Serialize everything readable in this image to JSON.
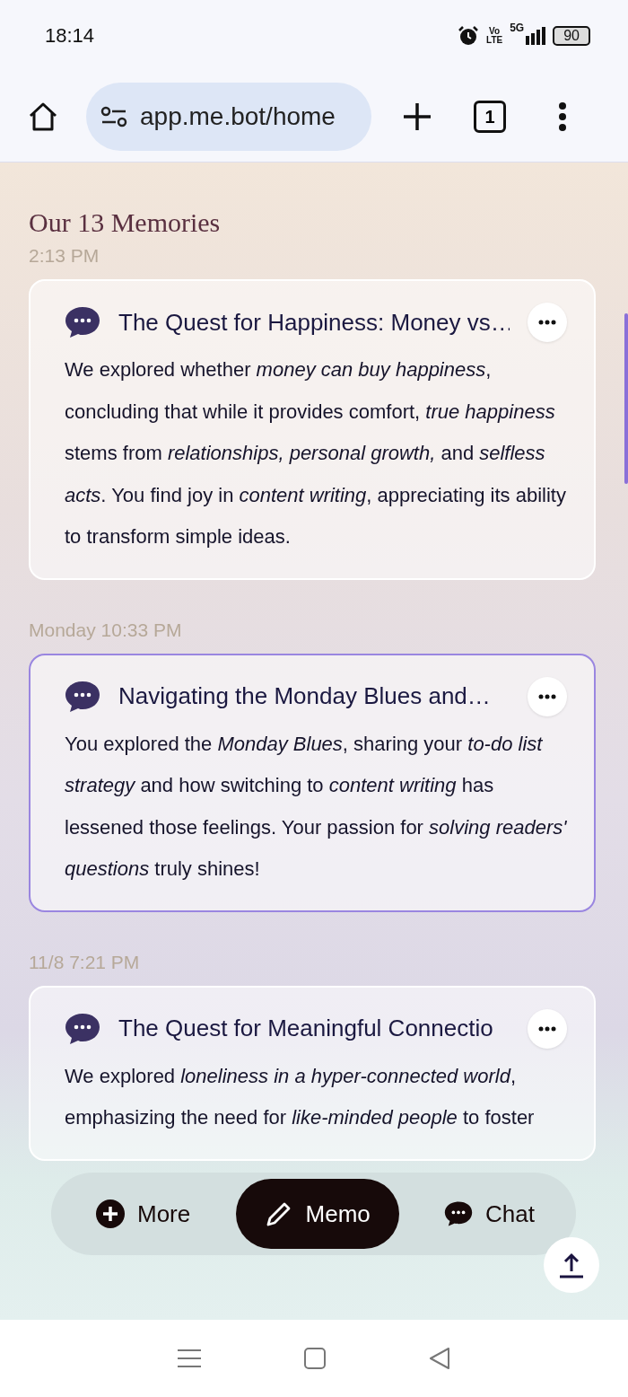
{
  "status_bar": {
    "time": "18:14",
    "volte": [
      "Vo",
      "LTE"
    ],
    "network": "5G",
    "battery": "90"
  },
  "browser": {
    "url": "app.me.bot/home",
    "tab_count": "1"
  },
  "heading": "Our 13 Memories",
  "memories": [
    {
      "time": "2:13 PM",
      "title": "The Quest for Happiness: Money vs…",
      "selected": false,
      "body": "We explored whether *money can buy happiness*, concluding that while it provides comfort, *true happiness* stems from *relationships, personal growth,* and *selfless acts*. You find joy in *content writing*, appreciating its ability to transform simple ideas."
    },
    {
      "time": "Monday 10:33 PM",
      "title": "Navigating the Monday Blues and…",
      "selected": true,
      "body": "You explored the *Monday Blues*, sharing your *to-do list strategy* and how switching to *content writing* has lessened those feelings. Your passion for *solving readers' questions* truly shines!"
    },
    {
      "time": "11/8 7:21 PM",
      "title": "The Quest for Meaningful Connectio",
      "selected": false,
      "body": "We explored *loneliness in a hyper-connected world*, emphasizing the need for *like-minded people* to foster"
    }
  ],
  "bottom_nav": [
    {
      "label": "More",
      "kind": "more",
      "selected": false
    },
    {
      "label": "Memo",
      "kind": "memo",
      "selected": true
    },
    {
      "label": "Chat",
      "kind": "chat",
      "selected": false
    }
  ]
}
